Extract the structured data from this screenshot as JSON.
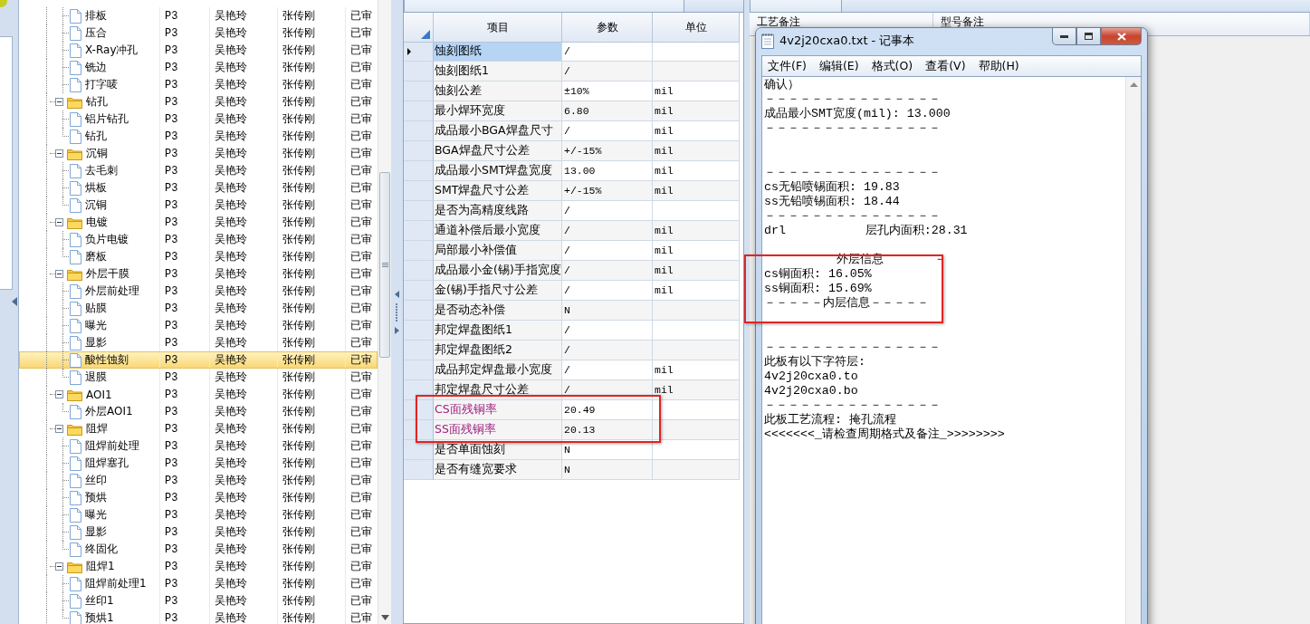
{
  "process_tree": {
    "items": [
      {
        "label": "排板",
        "kind": "file",
        "selected": false,
        "cells": [
          "P3",
          "吴艳玲",
          "张传刚",
          "已审"
        ]
      },
      {
        "label": "压合",
        "kind": "file",
        "selected": false,
        "cells": [
          "P3",
          "吴艳玲",
          "张传刚",
          "已审"
        ]
      },
      {
        "label": "X-Ray冲孔",
        "kind": "file",
        "selected": false,
        "cells": [
          "P3",
          "吴艳玲",
          "张传刚",
          "已审"
        ]
      },
      {
        "label": "铣边",
        "kind": "file",
        "selected": false,
        "cells": [
          "P3",
          "吴艳玲",
          "张传刚",
          "已审"
        ]
      },
      {
        "label": "打字唛",
        "kind": "file",
        "selected": false,
        "cells": [
          "P3",
          "吴艳玲",
          "张传刚",
          "已审"
        ]
      },
      {
        "label": "钻孔",
        "kind": "folder",
        "selected": false,
        "cells": [
          "P3",
          "吴艳玲",
          "张传刚",
          "已审"
        ],
        "children": [
          {
            "label": "铝片钻孔",
            "kind": "file",
            "selected": false,
            "cells": [
              "P3",
              "吴艳玲",
              "张传刚",
              "已审"
            ]
          },
          {
            "label": "钻孔",
            "kind": "file",
            "selected": false,
            "cells": [
              "P3",
              "吴艳玲",
              "张传刚",
              "已审"
            ]
          }
        ]
      },
      {
        "label": "沉铜",
        "kind": "folder",
        "selected": false,
        "cells": [
          "P3",
          "吴艳玲",
          "张传刚",
          "已审"
        ],
        "children": [
          {
            "label": "去毛刺",
            "kind": "file",
            "selected": false,
            "cells": [
              "P3",
              "吴艳玲",
              "张传刚",
              "已审"
            ]
          },
          {
            "label": "烘板",
            "kind": "file",
            "selected": false,
            "cells": [
              "P3",
              "吴艳玲",
              "张传刚",
              "已审"
            ]
          },
          {
            "label": "沉铜",
            "kind": "file",
            "selected": false,
            "cells": [
              "P3",
              "吴艳玲",
              "张传刚",
              "已审"
            ]
          }
        ]
      },
      {
        "label": "电镀",
        "kind": "folder",
        "selected": false,
        "cells": [
          "P3",
          "吴艳玲",
          "张传刚",
          "已审"
        ],
        "children": [
          {
            "label": "负片电镀",
            "kind": "file",
            "selected": false,
            "cells": [
              "P3",
              "吴艳玲",
              "张传刚",
              "已审"
            ]
          },
          {
            "label": "磨板",
            "kind": "file",
            "selected": false,
            "cells": [
              "P3",
              "吴艳玲",
              "张传刚",
              "已审"
            ]
          }
        ]
      },
      {
        "label": "外层干膜",
        "kind": "folder",
        "selected": false,
        "cells": [
          "P3",
          "吴艳玲",
          "张传刚",
          "已审"
        ],
        "children": [
          {
            "label": "外层前处理",
            "kind": "file",
            "selected": false,
            "cells": [
              "P3",
              "吴艳玲",
              "张传刚",
              "已审"
            ]
          },
          {
            "label": "贴膜",
            "kind": "file",
            "selected": false,
            "cells": [
              "P3",
              "吴艳玲",
              "张传刚",
              "已审"
            ]
          },
          {
            "label": "曝光",
            "kind": "file",
            "selected": false,
            "cells": [
              "P3",
              "吴艳玲",
              "张传刚",
              "已审"
            ]
          },
          {
            "label": "显影",
            "kind": "file",
            "selected": false,
            "cells": [
              "P3",
              "吴艳玲",
              "张传刚",
              "已审"
            ]
          },
          {
            "label": "酸性蚀刻",
            "kind": "file",
            "selected": true,
            "cells": [
              "P3",
              "吴艳玲",
              "张传刚",
              "已审"
            ]
          },
          {
            "label": "退膜",
            "kind": "file",
            "selected": false,
            "cells": [
              "P3",
              "吴艳玲",
              "张传刚",
              "已审"
            ]
          }
        ]
      },
      {
        "label": "AOI1",
        "kind": "folder",
        "selected": false,
        "cells": [
          "P3",
          "吴艳玲",
          "张传刚",
          "已审"
        ],
        "children": [
          {
            "label": "外层AOI1",
            "kind": "file",
            "selected": false,
            "cells": [
              "P3",
              "吴艳玲",
              "张传刚",
              "已审"
            ]
          }
        ]
      },
      {
        "label": "阻焊",
        "kind": "folder",
        "selected": false,
        "cells": [
          "P3",
          "吴艳玲",
          "张传刚",
          "已审"
        ],
        "children": [
          {
            "label": "阻焊前处理",
            "kind": "file",
            "selected": false,
            "cells": [
              "P3",
              "吴艳玲",
              "张传刚",
              "已审"
            ]
          },
          {
            "label": "阻焊塞孔",
            "kind": "file",
            "selected": false,
            "cells": [
              "P3",
              "吴艳玲",
              "张传刚",
              "已审"
            ]
          },
          {
            "label": "丝印",
            "kind": "file",
            "selected": false,
            "cells": [
              "P3",
              "吴艳玲",
              "张传刚",
              "已审"
            ]
          },
          {
            "label": "预烘",
            "kind": "file",
            "selected": false,
            "cells": [
              "P3",
              "吴艳玲",
              "张传刚",
              "已审"
            ]
          },
          {
            "label": "曝光",
            "kind": "file",
            "selected": false,
            "cells": [
              "P3",
              "吴艳玲",
              "张传刚",
              "已审"
            ]
          },
          {
            "label": "显影",
            "kind": "file",
            "selected": false,
            "cells": [
              "P3",
              "吴艳玲",
              "张传刚",
              "已审"
            ]
          },
          {
            "label": "终固化",
            "kind": "file",
            "selected": false,
            "cells": [
              "P3",
              "吴艳玲",
              "张传刚",
              "已审"
            ]
          }
        ]
      },
      {
        "label": "阻焊1",
        "kind": "folder",
        "selected": false,
        "cells": [
          "P3",
          "吴艳玲",
          "张传刚",
          "已审"
        ],
        "children": [
          {
            "label": "阻焊前处理1",
            "kind": "file",
            "selected": false,
            "cells": [
              "P3",
              "吴艳玲",
              "张传刚",
              "已审"
            ]
          },
          {
            "label": "丝印1",
            "kind": "file",
            "selected": false,
            "cells": [
              "P3",
              "吴艳玲",
              "张传刚",
              "已审"
            ]
          },
          {
            "label": "预烘1",
            "kind": "file",
            "selected": false,
            "cells": [
              "P3",
              "吴艳玲",
              "张传刚",
              "已审"
            ]
          }
        ]
      }
    ]
  },
  "params_panel": {
    "columns": [
      "项目",
      "参数",
      "单位"
    ],
    "rows": [
      {
        "item": "蚀刻图纸",
        "value": "/",
        "selected": true
      },
      {
        "item": "蚀刻图纸1",
        "value": "/",
        "selected": false
      },
      {
        "item": "蚀刻公差",
        "value": "±10%",
        "unit": "mil",
        "selected": false
      },
      {
        "item": "最小焊环宽度",
        "value": "6.80",
        "unit": "mil",
        "selected": false
      },
      {
        "item": "成品最小BGA焊盘尺寸",
        "value": "/",
        "unit": "mil",
        "selected": false
      },
      {
        "item": "BGA焊盘尺寸公差",
        "value": "+/-15%",
        "unit": "mil",
        "selected": false
      },
      {
        "item": "成品最小SMT焊盘宽度",
        "value": "13.00",
        "unit": "mil",
        "selected": false
      },
      {
        "item": "SMT焊盘尺寸公差",
        "value": "+/-15%",
        "unit": "mil",
        "selected": false
      },
      {
        "item": "是否为高精度线路",
        "value": "/",
        "selected": false
      },
      {
        "item": "通道补偿后最小宽度",
        "value": "/",
        "unit": "mil",
        "selected": false
      },
      {
        "item": "局部最小补偿值",
        "value": "/",
        "unit": "mil",
        "selected": false
      },
      {
        "item": "成品最小金(锡)手指宽度",
        "value": "/",
        "unit": "mil",
        "selected": false
      },
      {
        "item": "金(锡)手指尺寸公差",
        "value": "/",
        "unit": "mil",
        "selected": false
      },
      {
        "item": "是否动态补偿",
        "value": "N",
        "selected": false
      },
      {
        "item": "邦定焊盘图纸1",
        "value": "/",
        "selected": false
      },
      {
        "item": "邦定焊盘图纸2",
        "value": "/",
        "selected": false
      },
      {
        "item": "成品邦定焊盘最小宽度",
        "value": "/",
        "unit": "mil",
        "selected": false
      },
      {
        "item": "邦定焊盘尺寸公差",
        "value": "/",
        "unit": "mil",
        "selected": false
      },
      {
        "item": "CS面残铜率",
        "value": "20.49",
        "selected": false,
        "color": "#a0207f"
      },
      {
        "item": "SS面残铜率",
        "value": "20.13",
        "selected": false,
        "color": "#a0207f"
      },
      {
        "item": "是否单面蚀刻",
        "value": "N",
        "selected": false
      },
      {
        "item": "是否有缝宽要求",
        "value": "N",
        "selected": false
      }
    ]
  },
  "notes_panel": {
    "columns": [
      "工艺备注",
      "型号备注"
    ]
  },
  "notepad": {
    "title": "4v2j20cxa0.txt - 记事本",
    "menu": [
      "文件(F)",
      "编辑(E)",
      "格式(O)",
      "查看(V)",
      "帮助(H)"
    ],
    "blocks": [
      {
        "kind": "double-gap",
        "lines": [
          "确认）",
          "－－－－－－－－－－－－－－－",
          "成品最小SMT宽度(mil): 13.000",
          "－－－－－－－－－－－－－－－"
        ]
      },
      {
        "kind": "single-gap",
        "lines": [
          "－－－－－－－－－－－－－－－",
          "cs无铅喷锡面积: 19.83",
          "ss无铅喷锡面积: 18.44",
          "－－－－－－－－－－－－－－－",
          "drl           层孔内面积:28.31"
        ]
      },
      {
        "kind": "double-gap",
        "lines": [
          "          外层信息       －",
          "cs铜面积: 16.05%",
          "ss铜面积: 15.69%",
          "－－－－－内层信息－－－－－"
        ]
      },
      {
        "kind": "end",
        "lines": [
          "－－－－－－－－－－－－－－－",
          "此板有以下字符层:",
          "4v2j20cxa0.to",
          "4v2j20cxa0.bo",
          "－－－－－－－－－－－－－－－",
          "此板工艺流程: 掩孔流程",
          "<<<<<<<_请检查周期格式及备注_>>>>>>>>"
        ]
      }
    ]
  }
}
